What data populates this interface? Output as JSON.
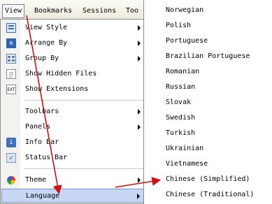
{
  "menubar": {
    "items": [
      "View",
      "Bookmarks",
      "Sessions",
      "Too"
    ]
  },
  "view_menu": {
    "items": [
      {
        "label": "View Style",
        "icon": "view-style-icon",
        "submenu": true
      },
      {
        "label": "Arrange By",
        "icon": "arrange-by-icon",
        "submenu": true
      },
      {
        "label": "Group By",
        "icon": "group-by-icon",
        "submenu": true
      },
      {
        "label": "Show Hidden Files",
        "icon": "hidden-files-icon",
        "submenu": false
      },
      {
        "label": "Show Extensions",
        "icon": "extensions-icon",
        "submenu": false
      },
      {
        "label": "Toolbars",
        "icon": "",
        "submenu": true
      },
      {
        "label": "Panels",
        "icon": "",
        "submenu": true
      },
      {
        "label": "Info Bar",
        "icon": "info-bar-icon",
        "submenu": false
      },
      {
        "label": "Status Bar",
        "icon": "checkmark-icon",
        "submenu": false
      },
      {
        "label": "Theme",
        "icon": "theme-icon",
        "submenu": true
      },
      {
        "label": "Language",
        "icon": "",
        "submenu": true
      }
    ]
  },
  "language_submenu": {
    "items": [
      "Norwegian",
      "Polish",
      "Portuguese",
      "Brazilian Portuguese",
      "Romanian",
      "Russian",
      "Slovak",
      "Swedish",
      "Turkish",
      "Ukrainian",
      "Vietnamese",
      "Chinese (Simplified)",
      "Chinese (Traditional)"
    ]
  },
  "colors": {
    "annotation_arrow": "#d01010",
    "highlight": "#c6d6f3"
  }
}
